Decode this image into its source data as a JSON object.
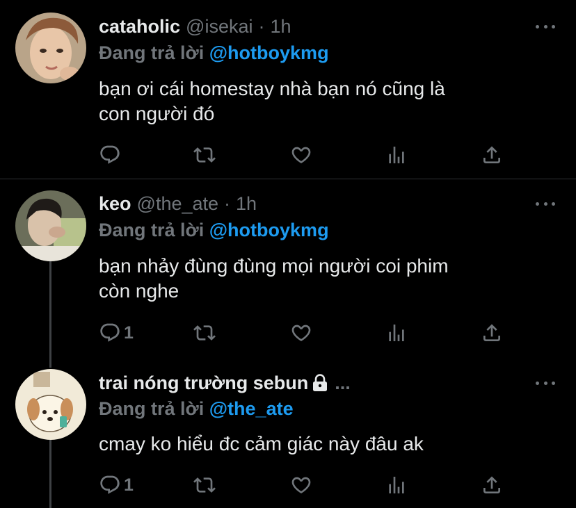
{
  "tweets": [
    {
      "name": "cataholic",
      "handle": "@isekai",
      "sep": "·",
      "time": "1h",
      "reply_prefix": "Đang trả lời",
      "reply_to": "@hotboykmg",
      "text_line1": "bạn ơi cái homestay nhà bạn nó cũng là",
      "text_line2": "con người đó"
    },
    {
      "name": "keo",
      "handle": "@the_ate",
      "sep": "·",
      "time": "1h",
      "reply_prefix": "Đang trả lời",
      "reply_to": "@hotboykmg",
      "text_line1": "bạn nhảy đùng đùng mọi người coi phim",
      "text_line2": "còn nghe",
      "reply_count": "1"
    },
    {
      "name": "trai nóng trường sebun",
      "ellipsis": "...",
      "reply_prefix": "Đang trả lời",
      "reply_to": "@the_ate",
      "text_line1": "cmay ko hiểu đc cảm giác này đâu ak",
      "reply_count": "1"
    }
  ],
  "colors": {
    "background": "#000000",
    "text": "#e7e9ea",
    "secondary": "#71767b",
    "link": "#1d9bf0"
  }
}
